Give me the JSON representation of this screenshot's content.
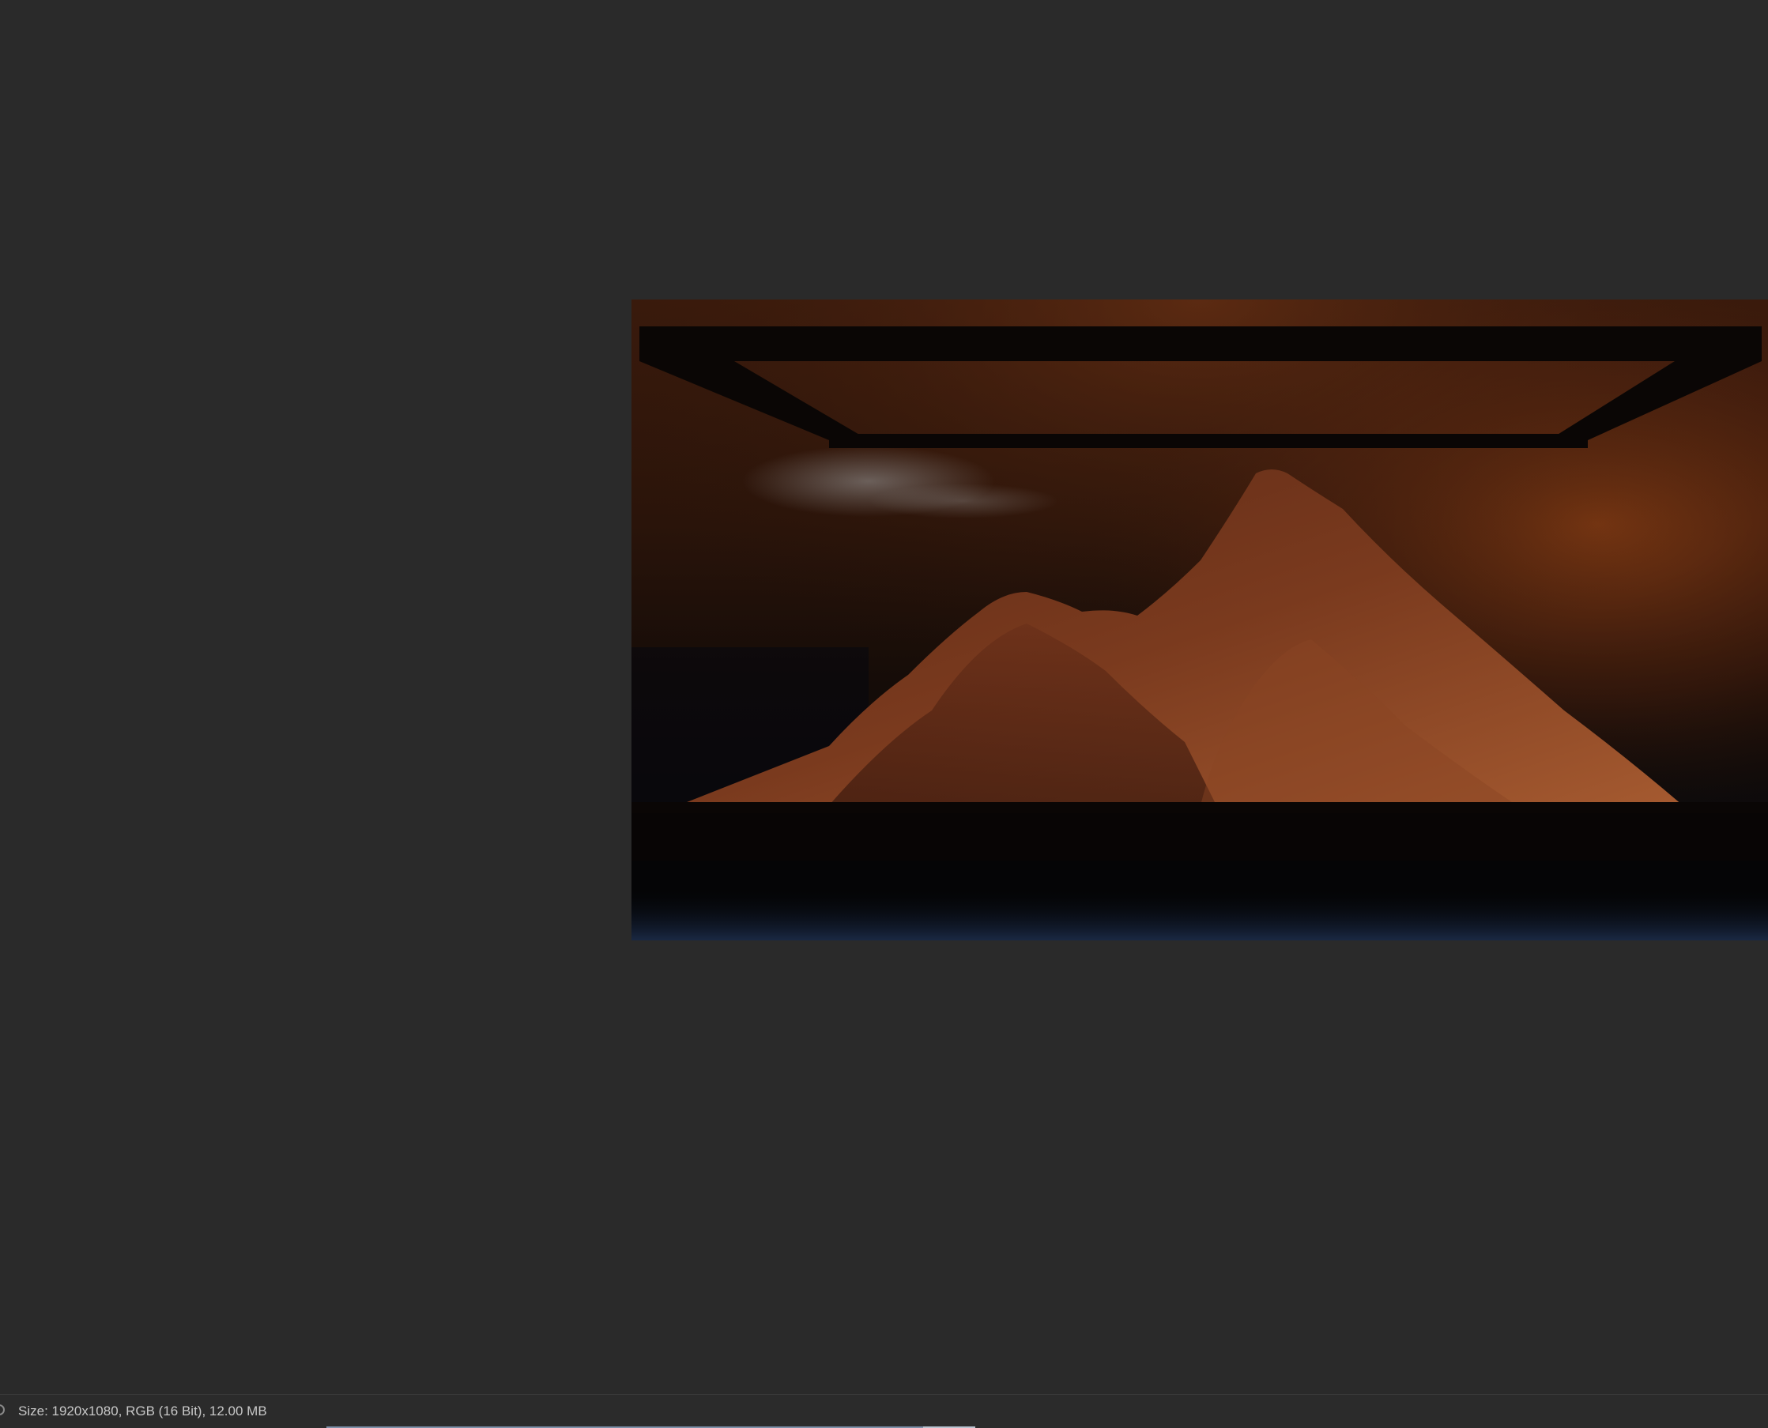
{
  "status_bar": {
    "info_text": "Size: 1920x1080, RGB (16 Bit), 12.00 MB"
  },
  "preview": {
    "description_icon": "rendered-image-preview"
  },
  "colors": {
    "workspace_bg": "#2a2a2a",
    "status_text": "#c8c8c8"
  }
}
